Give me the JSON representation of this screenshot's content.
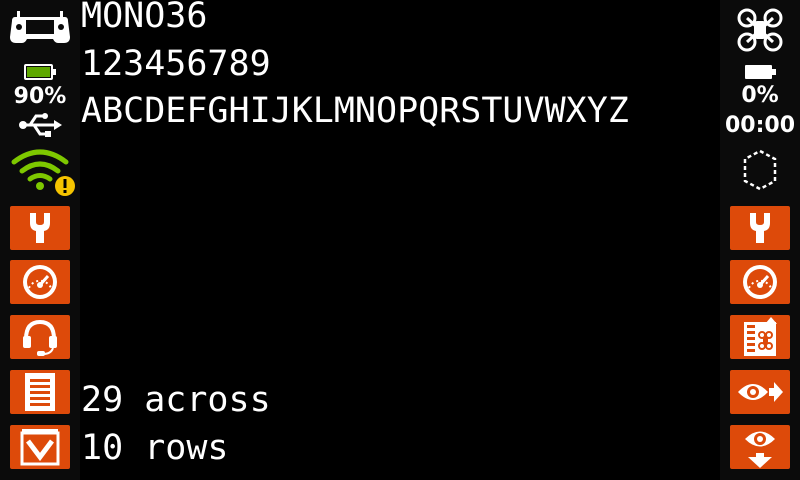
{
  "main": {
    "font_name": "MONO36",
    "digits": "123456789",
    "alphabet": "ABCDEFGHIJKLMNOPQRSTUVWXYZ",
    "across_text": "29 across",
    "rows_text": "10 rows"
  },
  "left_bar": {
    "battery_percent": "90%",
    "battery_level": 0.9,
    "icons": [
      "radio-handset-icon",
      "battery-icon",
      "usb-icon",
      "wifi-warning-icon"
    ],
    "buttons": [
      "tools-button",
      "gauge-button",
      "headset-button",
      "document-button",
      "dropdown-button"
    ]
  },
  "right_bar": {
    "battery_percent": "0%",
    "battery_level": 0.0,
    "timer": "00:00",
    "icons": [
      "drone-icon",
      "battery-icon",
      "shape-outline-icon"
    ],
    "buttons": [
      "tools-button",
      "gauge-button",
      "model-list-button",
      "view-forward-button",
      "view-down-button"
    ]
  },
  "colors": {
    "accent": "#dd4a0a",
    "battery_green": "#5fa800",
    "wifi_green": "#7ec800",
    "warning": "#f5c400"
  }
}
